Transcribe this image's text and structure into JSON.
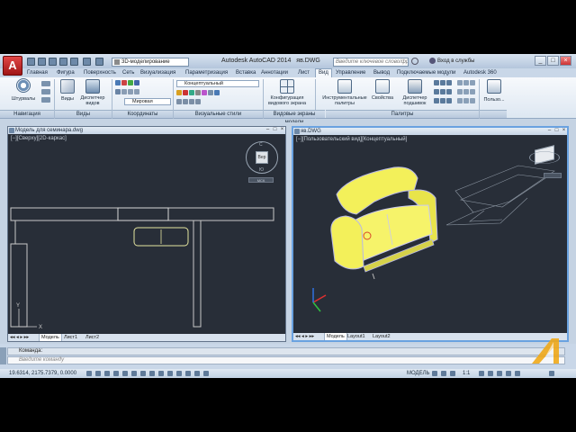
{
  "window": {
    "title": "Autodesk AutoCAD 2014",
    "file": "яв.DWG",
    "workspace": "3D-моделирование",
    "search_placeholder": "Введите ключевое слово/фразу",
    "signin": "Вход в службы",
    "app_letter": "A"
  },
  "ribbon_tabs": [
    "Главная",
    "Фигура",
    "Поверхность",
    "Сеть",
    "Визуализация",
    "Параметризация",
    "Вставка",
    "Аннотации",
    "Лист",
    "Вид",
    "Управление",
    "Вывод",
    "Подключаемые модули",
    "Autodesk 360"
  ],
  "ribbon": {
    "steering": "Штурвалы",
    "views": "Виды",
    "view_manager_1": "Диспетчер",
    "view_manager_2": "видов",
    "visual_style": "Концептуальный",
    "world": "Мировая",
    "vp_config_1": "Конфигурация",
    "vp_config_2": "видового экрана",
    "tool_palettes_1": "Инструментальные",
    "tool_palettes_2": "палитры",
    "properties": "Свойства",
    "sheet_set_1": "Диспетчер",
    "sheet_set_2": "подшивок",
    "user_interface": "Пользо..."
  },
  "panels": [
    "Навигация",
    "Виды",
    "Координаты",
    "Визуальные стили",
    "Видовые экраны модели",
    "Палитры"
  ],
  "viewport_left": {
    "title": "Модель для семинара.dwg",
    "label": "[−][Сверху][2D-каркас]",
    "tabs": [
      "Модель",
      "Лист1",
      "Лист2"
    ],
    "cube_top": "С",
    "cube_face": "Вер",
    "cube_bottom": "Ю",
    "ucs_label": "МСК"
  },
  "viewport_right": {
    "title": "яв.DWG",
    "label": "[−][Пользовательский вид][Концептуальный]",
    "tabs": [
      "Модель",
      "Layout1",
      "Layout2"
    ]
  },
  "command": {
    "label": "Команда:",
    "placeholder": "Введите команду"
  },
  "status": {
    "coords": "19.6314, 2175.7379, 0.0000",
    "model": "МОДЕЛЬ",
    "scale": "1:1"
  },
  "colors": {
    "viewport_bg": "#282e38",
    "sofa": "#f3f05a",
    "accent": "#1e6fd0",
    "logo": "#f0a818"
  }
}
